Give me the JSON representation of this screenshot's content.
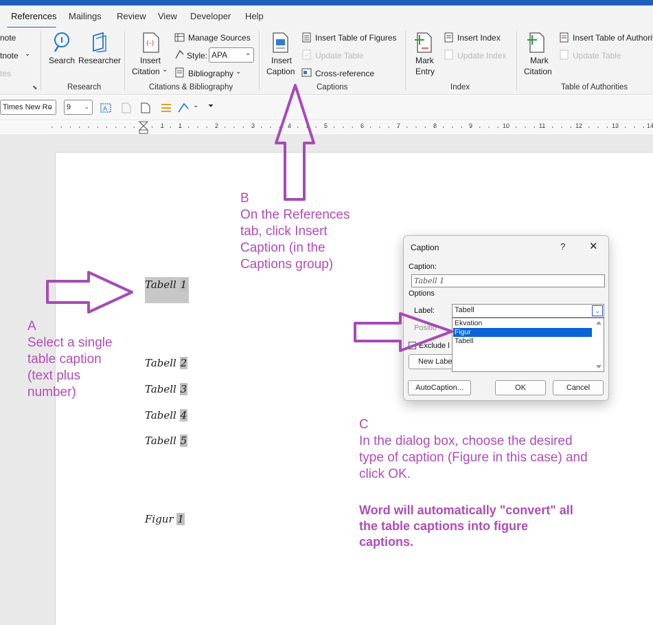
{
  "tabs": [
    "References",
    "Mailings",
    "Review",
    "View",
    "Developer",
    "Help"
  ],
  "ribbon": {
    "left_cut": [
      "note",
      "tnote",
      "tes"
    ],
    "search": "Search",
    "researcher": "Researcher",
    "research_group": "Research",
    "insert_citation_line1": "Insert",
    "insert_citation_line2": "Citation",
    "manage_sources": "Manage Sources",
    "style_label": "Style:",
    "style_value": "APA",
    "bibliography": "Bibliography",
    "citations_group": "Citations & Bibliography",
    "insert_caption_line1": "Insert",
    "insert_caption_line2": "Caption",
    "insert_table_of_figures": "Insert Table of Figures",
    "update_table": "Update Table",
    "cross_reference": "Cross-reference",
    "captions_group": "Captions",
    "mark_entry_line1": "Mark",
    "mark_entry_line2": "Entry",
    "insert_index": "Insert Index",
    "update_index": "Update Index",
    "index_group": "Index",
    "mark_citation_line1": "Mark",
    "mark_citation_line2": "Citation",
    "insert_table_of_authorities": "Insert Table of Authorities",
    "update_table_auth": "Update Table",
    "authorities_group": "Table of Authorities"
  },
  "toolbar": {
    "font": "Times New Ro",
    "size": "9"
  },
  "ruler_numbers": [
    "1",
    "1",
    "2",
    "3",
    "4",
    "5",
    "6",
    "7",
    "8",
    "9",
    "10",
    "11",
    "12",
    "13",
    "14"
  ],
  "document": {
    "captions": [
      {
        "word": "Tabell",
        "num": "1"
      },
      {
        "word": "Tabell",
        "num": "2"
      },
      {
        "word": "Tabell",
        "num": "3"
      },
      {
        "word": "Tabell",
        "num": "4"
      },
      {
        "word": "Tabell",
        "num": "5"
      },
      {
        "word": "Figur",
        "num": "1"
      }
    ]
  },
  "annotations": {
    "a": "A\nSelect a single\ntable caption\n(text plus\nnumber)",
    "b": "B\nOn the References\ntab, click Insert\nCaption (in the\nCaptions group)",
    "c": "C\nIn the dialog box, choose the desired\ntype of caption (Figure in this case) and\nclick OK.",
    "note": "Word will automatically \"convert\" all\nthe table captions into figure\ncaptions."
  },
  "dialog": {
    "title": "Caption",
    "help": "?",
    "close": "✕",
    "caption_label": "Caption:",
    "caption_value": "Tabell 1",
    "options_label": "Options",
    "label_label": "Label:",
    "label_value": "Tabell",
    "options": [
      "Ekvation",
      "Figur",
      "Tabell"
    ],
    "selected_option": "Figur",
    "position_label": "Positio",
    "exclude_label": "Exclude l",
    "new_label": "New Label",
    "autocaption": "AutoCaption...",
    "ok": "OK",
    "cancel": "Cancel"
  },
  "colors": {
    "annotation": "#b04cb8",
    "arrow": "#a64bb5",
    "accent": "#1f5fbf",
    "selection": "#0a64d7"
  },
  "icons": [
    "search-icon",
    "researcher-icon",
    "insert-citation-icon",
    "manage-sources-icon",
    "style-icon",
    "bibliography-icon",
    "insert-caption-icon",
    "table-of-figures-icon",
    "update-table-icon",
    "cross-reference-icon",
    "mark-entry-icon",
    "insert-index-icon",
    "update-index-icon",
    "mark-citation-icon",
    "table-of-authorities-icon",
    "dialog-launcher-icon"
  ]
}
